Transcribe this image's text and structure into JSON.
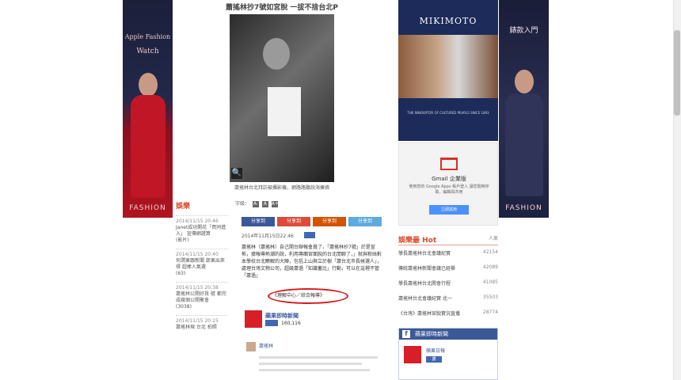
{
  "left_banner": {
    "title_line1": "Apple Fashion",
    "title_line2": "Watch",
    "foot": "FASHION"
  },
  "right_banner": {
    "title": "錶款入門",
    "foot": "FASHION"
  },
  "article": {
    "headline": "蕭搖林抄7號如宮脫   一拔不捨台北P",
    "caption": "蕭搖林台北拜訪被攝影機，網路路聽說海擁擠",
    "font_label": "字級：",
    "font_sizes": [
      "A-",
      "A",
      "A+"
    ],
    "share_buttons": [
      {
        "label": "分享到",
        "color": "#3b5998"
      },
      {
        "label": "分享到",
        "color": "#dd4b39"
      },
      {
        "label": "分享到Plurk",
        "color": "#d35400"
      },
      {
        "label": "分享到",
        "color": "#5eaade"
      }
    ],
    "meta": "2014年11月15日22:46",
    "body": "蕭搖林（蕭搖林）自己開台辦報會員了，「蕭搖林抄7號」於是宣佈，據報導熱潮的說，利用專團宮面脫的台北閒聊了，」就與粉絲對本學校台北瞭解的大陣，包括上山與立於樹「蕭台北市長候選人」，處理台灣文物公司，超級蕭過「知識蓄比」行動，可以在這裡不管「蕭過」",
    "highlight": "《理解中心／綜合報導》",
    "fanpage_name": "蘋果即時新聞",
    "fanpage_count": "160,116",
    "commenter": "蕭搖林"
  },
  "news_list": {
    "title": "娛樂",
    "items": [
      {
        "time": "2014/11/15 20:46",
        "text": "Janet成功開花「買同進入」 宣傳網證算",
        "tag": "(影片)"
      },
      {
        "time": "2014/11/15 20:40",
        "text": "何潤東跟新聞 蔬果出來 得 超棒人氣選",
        "tag": "(63)"
      },
      {
        "time": "2014/11/15 20:38",
        "text": "蕭搖林公開好貨 號 都完成幾個公開聚會",
        "tag": "(3038)"
      },
      {
        "time": "2014/11/15 20:15",
        "text": "蕭搖林現 台北 拍照",
        "tag": ""
      }
    ]
  },
  "sidebar": {
    "mikimoto_logo": "MIKIMOTO",
    "mikimoto_tag": "THE INNOVATOR OF CULTURED PEARLS SINCE 1893",
    "gmail_title": "Gmail 企業版",
    "gmail_text": "使用您的 Google Apps 帳戶登入 讓您隨時存取、編輯與共用",
    "gmail_button": "立即試用",
    "hot_title": "娛樂最 Hot",
    "hot_more": "人氣",
    "hot_items": [
      {
        "text": "學長蕭搖林台北會議紀實",
        "count": "42154"
      },
      {
        "text": "傳統蕭搖林新聞會議已經舉",
        "count": "42089"
      },
      {
        "text": "學長蕭搖林台北開會行程",
        "count": "41085"
      },
      {
        "text": "蕭搖林台北會議紀實 北一",
        "count": "35503"
      },
      {
        "text": "《台灣》蕭搖林宮脫實況直播",
        "count": "28774"
      }
    ],
    "fb_title": "蘋果即時新聞",
    "fb_page": "蘋果日報",
    "fb_like": "讚"
  }
}
